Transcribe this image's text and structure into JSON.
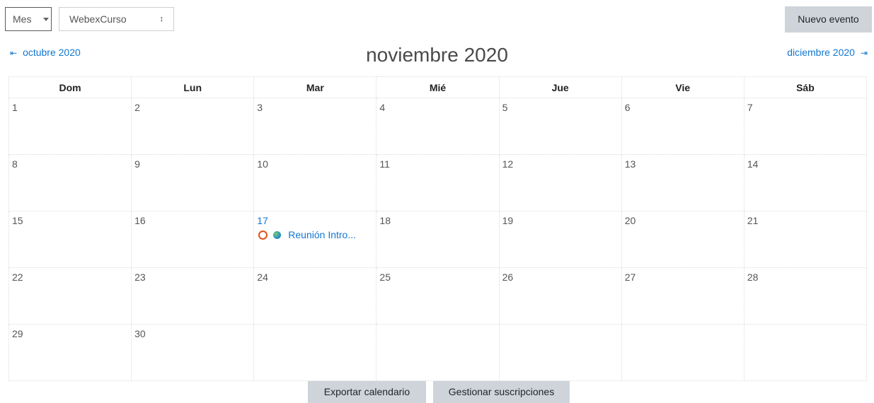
{
  "controls": {
    "view_select": "Mes",
    "course_select": "WebexCurso",
    "new_event_label": "Nuevo evento"
  },
  "navigation": {
    "prev_month": "octubre 2020",
    "current_month": "noviembre 2020",
    "next_month": "diciembre 2020"
  },
  "calendar": {
    "weekdays": [
      "Dom",
      "Lun",
      "Mar",
      "Mié",
      "Jue",
      "Vie",
      "Sáb"
    ],
    "weeks": [
      [
        "1",
        "2",
        "3",
        "4",
        "5",
        "6",
        "7"
      ],
      [
        "8",
        "9",
        "10",
        "11",
        "12",
        "13",
        "14"
      ],
      [
        "15",
        "16",
        "17",
        "18",
        "19",
        "20",
        "21"
      ],
      [
        "22",
        "23",
        "24",
        "25",
        "26",
        "27",
        "28"
      ],
      [
        "29",
        "30",
        "",
        "",
        "",
        "",
        ""
      ]
    ],
    "today": "17",
    "event": {
      "day": "17",
      "title": "Reunión Intro..."
    }
  },
  "footer": {
    "export_label": "Exportar calendario",
    "manage_label": "Gestionar suscripciones"
  },
  "colors": {
    "link": "#1177d1",
    "button_bg": "#ced4da",
    "event_ring": "#e2531a"
  },
  "icons": {
    "prev_arrow": "arrow-left-icon",
    "next_arrow": "arrow-right-icon",
    "event_type": "course-event-icon",
    "event_globe": "globe-icon"
  }
}
